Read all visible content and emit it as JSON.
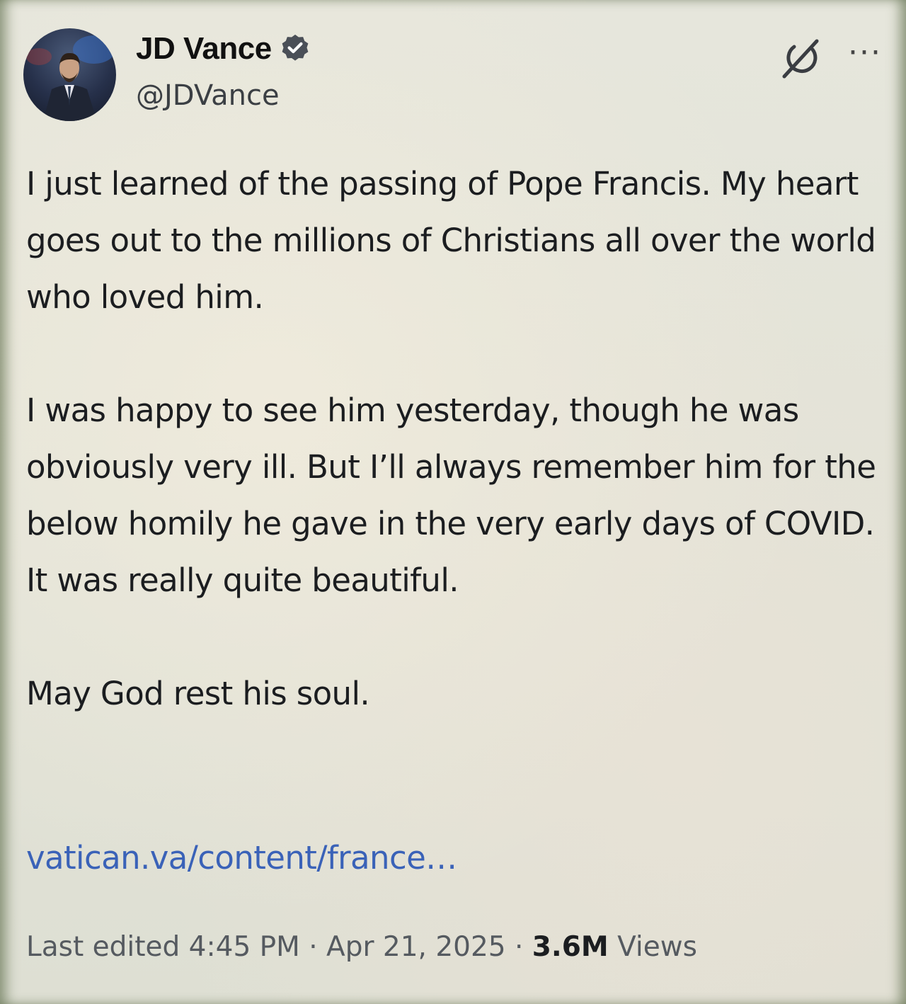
{
  "author": {
    "name": "JD Vance",
    "handle": "@JDVance",
    "verified_icon": "verified-badge-icon",
    "avatar_icon": "avatar-photo"
  },
  "header_actions": {
    "grok_icon": "grok-icon",
    "more_label": "···"
  },
  "post": {
    "paragraphs": [
      "I just learned of the passing of Pope Francis. My heart goes out to the millions of Christians all over the world who loved him.",
      "I was happy to see him yesterday, though he was obviously very ill. But I’ll always remember him for the below homily he gave in the very early days of COVID. It was really quite beautiful.",
      "May God rest his soul."
    ],
    "link_text": "vatican.va/content/france…"
  },
  "meta": {
    "edited_prefix": "Last edited ",
    "time": "4:45 PM",
    "separator": " · ",
    "date": "Apr 21, 2025",
    "views_count": "3.6M",
    "views_label": " Views"
  },
  "colors": {
    "link": "#3a62b8",
    "text": "#1b1d20",
    "muted": "#555a60"
  }
}
